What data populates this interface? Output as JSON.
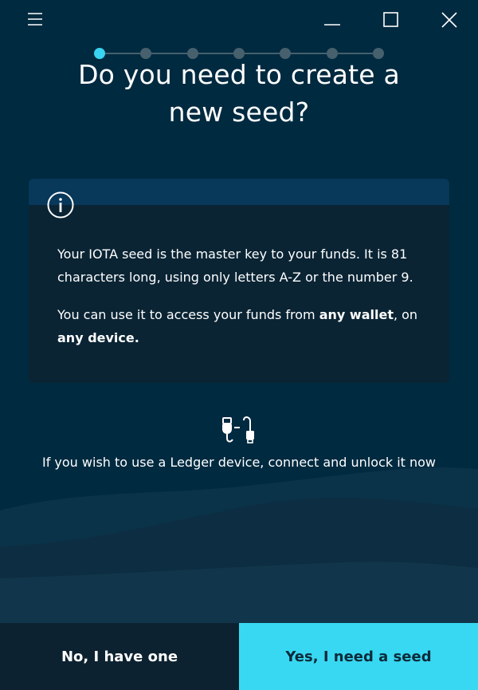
{
  "window": {
    "menu_icon": "hamburger-menu-icon",
    "minimize_icon": "minimize-icon",
    "maximize_icon": "maximize-icon",
    "close_icon": "close-icon"
  },
  "progress": {
    "total_steps": 7,
    "current_step": 1
  },
  "title": "Do you need to create a new seed?",
  "info": {
    "icon": "info-icon",
    "paragraph1": "Your IOTA seed is the master key to your funds. It is 81 characters long, using only letters A-Z or the number 9.",
    "paragraph2_prefix": "You can use it to access your funds from ",
    "paragraph2_bold1": "any wallet",
    "paragraph2_middle": ", on ",
    "paragraph2_bold2": "any device."
  },
  "ledger": {
    "icon": "usb-cable-icon",
    "text": "If you wish to use a Ledger device, connect and unlock it now"
  },
  "buttons": {
    "no_label": "No, I have one",
    "yes_label": "Yes, I need a seed"
  },
  "colors": {
    "background": "#002a40",
    "accent": "#38d8f2",
    "card": "#0a2434",
    "card_header": "#08385a"
  }
}
